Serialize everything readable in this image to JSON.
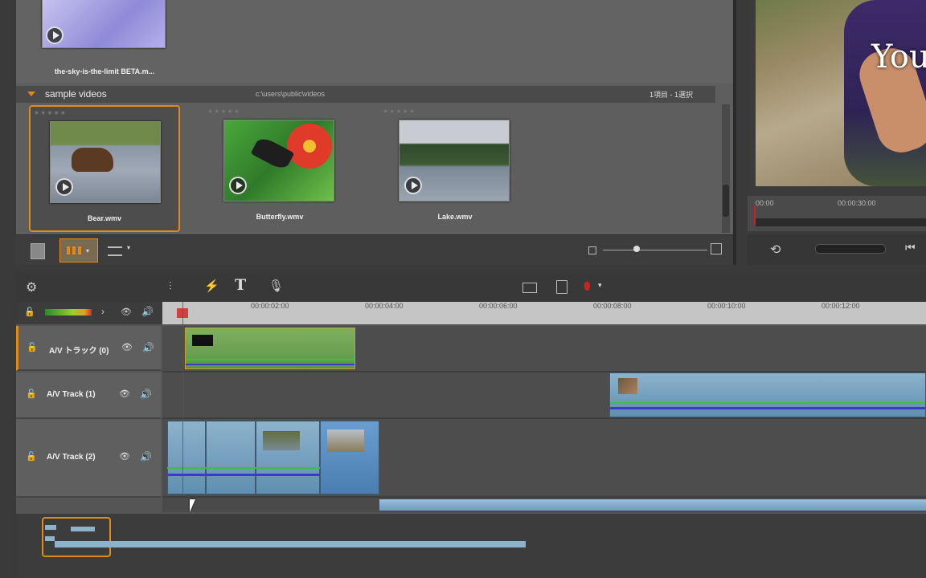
{
  "library": {
    "top_item": {
      "caption": "the-sky-is-the-limit BETA.m..."
    },
    "group": {
      "title": "sample videos",
      "path": "c:\\users\\public\\videos",
      "count": "1項目 - 1選択"
    },
    "items": [
      {
        "caption": "Bear.wmv",
        "stars": "★★★★★"
      },
      {
        "caption": "Butterfly.wmv",
        "stars": "★★★★★"
      },
      {
        "caption": "Lake.wmv",
        "stars": "★★★★★"
      }
    ]
  },
  "player": {
    "overlay_text": "You",
    "time_start": "00:00",
    "time_mid": "00:00:30:00"
  },
  "timeline": {
    "ruler": [
      "00:00:02:00",
      "00:00:04:00",
      "00:00:06:00",
      "00:00:08:00",
      "00:00:10:00",
      "00:00:12:00"
    ],
    "tracks": [
      {
        "name": "A/V トラック (0)"
      },
      {
        "name": "A/V Track (1)"
      },
      {
        "name": "A/V Track (2)"
      }
    ]
  },
  "colors": {
    "accent": "#e08a1e",
    "audio_line_green": "#3fbf3f",
    "audio_line_blue": "#3a3acc",
    "playhead": "#d02020"
  }
}
